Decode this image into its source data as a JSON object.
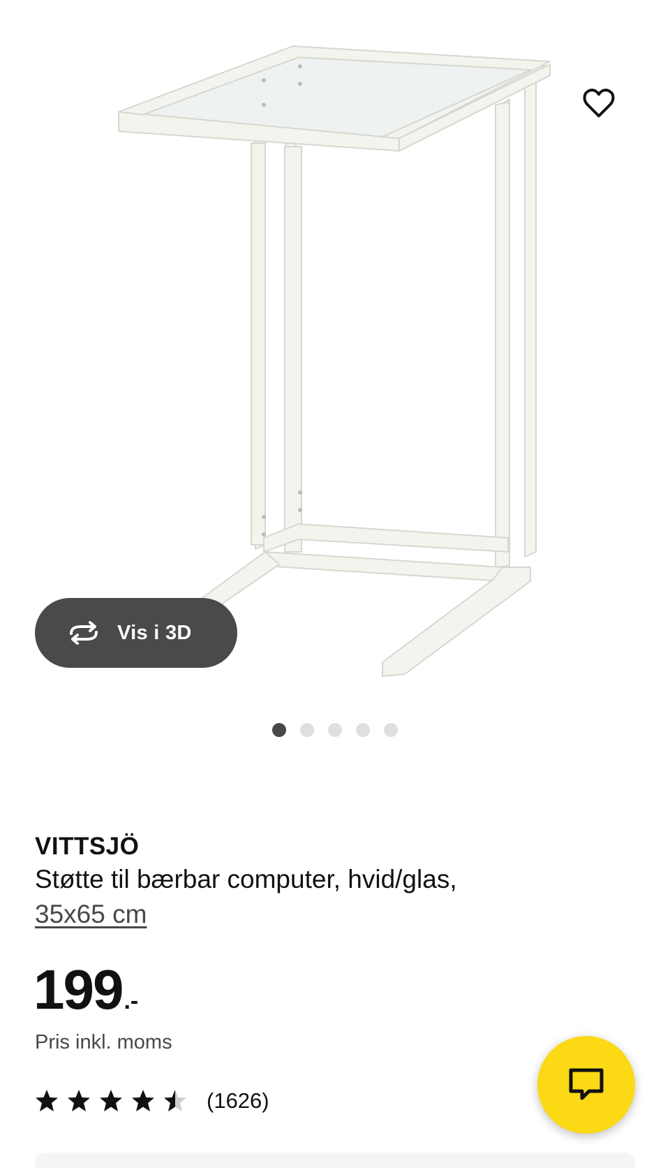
{
  "gallery": {
    "view_3d_label": "Vis i 3D",
    "total_images": 5,
    "active_image": 1
  },
  "product": {
    "name": "VITTSJÖ",
    "description": "Støtte til bærbar computer, hvid/glas,",
    "size": "35x65 cm",
    "price_integer": "199",
    "price_suffix": ".-",
    "vat_note": "Pris inkl. moms",
    "rating_value": 4.5,
    "rating_max": 5,
    "review_count": "(1626)"
  },
  "icons": {
    "favorite": "heart-outline-icon",
    "view_3d": "rotate-3d-icon",
    "chat": "chat-bubble-icon",
    "star": "star-icon"
  },
  "colors": {
    "chat_button": "#fbd914",
    "view_3d_button": "#4a4a4a",
    "dot_active": "#484848",
    "dot_inactive": "#dfdfdf"
  }
}
